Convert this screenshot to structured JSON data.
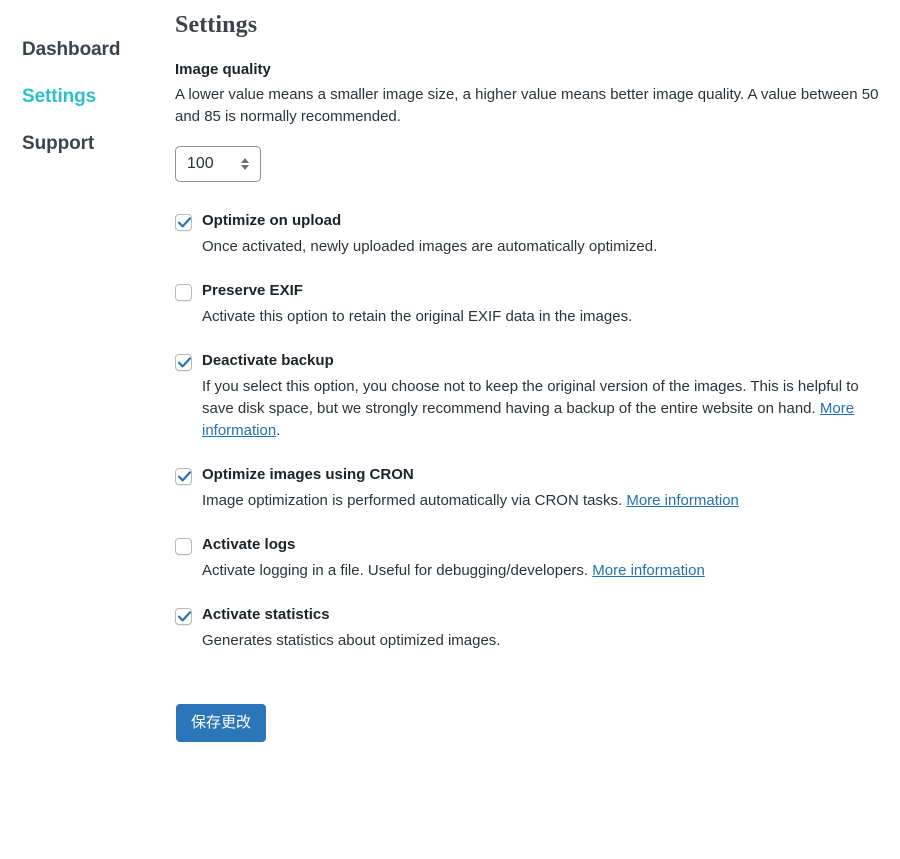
{
  "sidebar": {
    "items": [
      {
        "label": "Dashboard",
        "active": false
      },
      {
        "label": "Settings",
        "active": true
      },
      {
        "label": "Support",
        "active": false
      }
    ]
  },
  "main": {
    "title": "Settings",
    "image_quality": {
      "label": "Image quality",
      "description": "A lower value means a smaller image size, a higher value means better image quality. A value between 50 and 85 is normally recommended.",
      "value": "100"
    },
    "options": [
      {
        "title": "Optimize on upload",
        "checked": true,
        "desc_before": "Once activated, newly uploaded images are automatically optimized.",
        "link": "",
        "desc_after": ""
      },
      {
        "title": "Preserve EXIF",
        "checked": false,
        "desc_before": "Activate this option to retain the original EXIF data in the images.",
        "link": "",
        "desc_after": ""
      },
      {
        "title": "Deactivate backup",
        "checked": true,
        "desc_before": "If you select this option, you choose not to keep the original version of the images. This is helpful to save disk space, but we strongly recommend having a backup of the entire website on hand. ",
        "link": "More information",
        "desc_after": "."
      },
      {
        "title": "Optimize images using CRON",
        "checked": true,
        "desc_before": "Image optimization is performed automatically via CRON tasks. ",
        "link": "More information",
        "desc_after": ""
      },
      {
        "title": "Activate logs",
        "checked": false,
        "desc_before": "Activate logging in a file. Useful for debugging/developers. ",
        "link": "More information",
        "desc_after": ""
      },
      {
        "title": "Activate statistics",
        "checked": true,
        "desc_before": "Generates statistics about optimized images.",
        "link": "",
        "desc_after": ""
      }
    ],
    "submit_label": "保存更改"
  },
  "colors": {
    "accent": "#2bbfca",
    "link": "#2271b1",
    "button": "#2b76b9",
    "checkbox_check": "#2271b1",
    "text": "#1d2327"
  }
}
